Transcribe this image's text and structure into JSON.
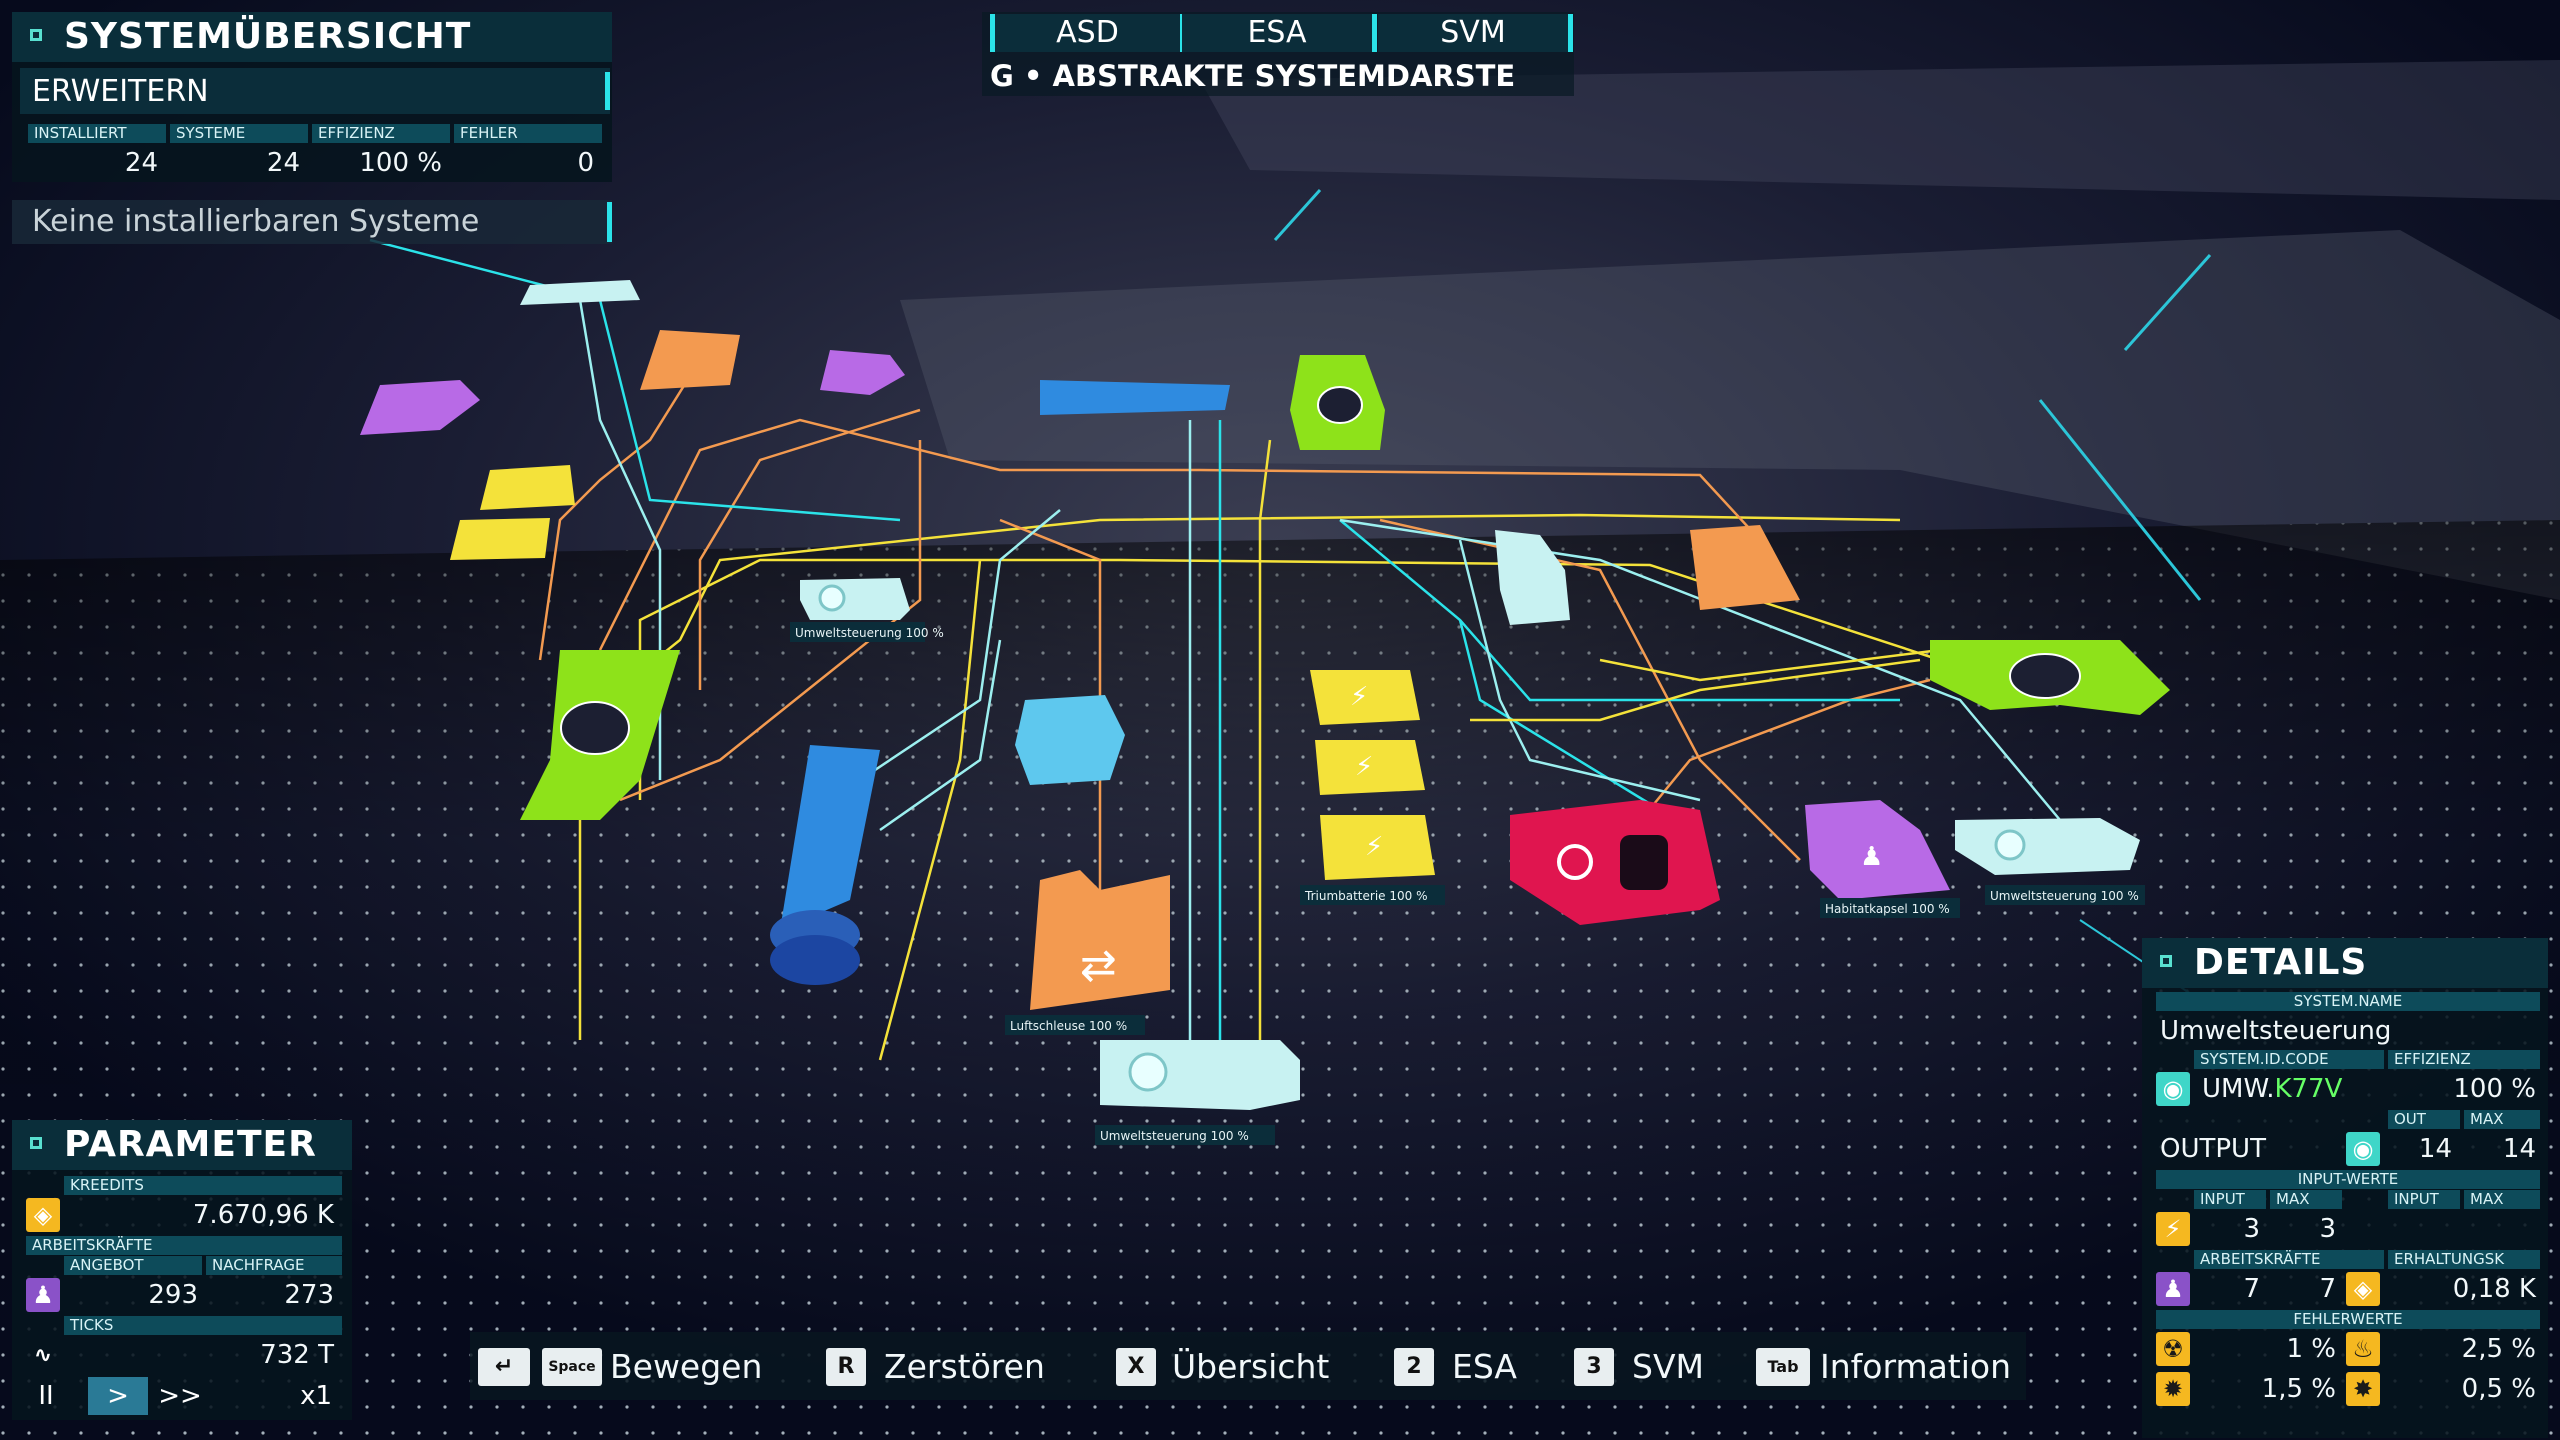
{
  "system_overview": {
    "title": "SYSTEMÜBERSICHT",
    "action": "ERWEITERN",
    "stats": [
      {
        "label": "INSTALLIERT",
        "value": "24"
      },
      {
        "label": "SYSTEME",
        "value": "24"
      },
      {
        "label": "EFFIZIENZ",
        "value": "100 %"
      },
      {
        "label": "FEHLER",
        "value": "0"
      }
    ],
    "message": "Keine installierbaren Systeme"
  },
  "top_tabs": {
    "tabs": [
      "ASD",
      "ESA",
      "SVM"
    ],
    "subtitle": "G • ABSTRAKTE SYSTEMDARSTE"
  },
  "parameter": {
    "title": "PARAMETER",
    "credits_label": "KREEDITS",
    "credits_value": "7.670,96 K",
    "workforce_label": "ARBEITSKRÄFTE",
    "supply_label": "ANGEBOT",
    "demand_label": "NACHFRAGE",
    "supply_value": "293",
    "demand_value": "273",
    "ticks_label": "TICKS",
    "ticks_value": "732 T",
    "controls": {
      "pause": "II",
      "play": ">",
      "fast": ">>",
      "speed": "x1"
    }
  },
  "details": {
    "title": "DETAILS",
    "system_name_label": "SYSTEM.NAME",
    "system_name": "Umweltsteuerung",
    "id_code_label": "SYSTEM.ID.CODE",
    "efficiency_label": "EFFIZIENZ",
    "id_prefix": "UMW.",
    "id_suffix": "K77V",
    "efficiency_value": "100 %",
    "out_label": "OUT",
    "max_label": "MAX",
    "output_label": "OUTPUT",
    "output_out": "14",
    "output_max": "14",
    "input_values_label": "INPUT-WERTE",
    "input_label": "INPUT",
    "input_max_label": "MAX",
    "input_label2": "INPUT",
    "input_max_label2": "MAX",
    "input_value": "3",
    "input_max": "3",
    "workforce_label": "ARBEITSKRÄFTE",
    "upkeep_label": "ERHALTUNGSK",
    "workforce_a": "7",
    "workforce_b": "7",
    "upkeep_value": "0,18 K",
    "error_values_label": "FEHLERWERTE",
    "errors": [
      "1 %",
      "2,5 %",
      "1,5 %",
      "0,5 %"
    ],
    "colors": {
      "accent": "#2be3e9",
      "id_green": "#66ff66",
      "icon_yellow": "#f5b820",
      "icon_purple": "#8a52c8"
    }
  },
  "hotkeys": [
    {
      "key": "Space",
      "label": "Bewegen"
    },
    {
      "key": "R",
      "label": "Zerstören"
    },
    {
      "key": "X",
      "label": "Übersicht"
    },
    {
      "key": "2",
      "label": "ESA"
    },
    {
      "key": "3",
      "label": "SVM"
    },
    {
      "key": "Tab",
      "label": "Information"
    }
  ],
  "map_labels": {
    "umwelt_main": "Umweltsteuerung  100 %",
    "luftschleuse": "Luftschleuse  100 %",
    "habitat": "Habitatkapsel  100 %",
    "umwelt_right": "Umweltsteuerung  100 %",
    "battery": "Triumbatterie  100 %",
    "umwelt_left": "Umweltsteuerung  100 %"
  },
  "node_colors": {
    "yellow": "#f4e23a",
    "orange": "#f39a50",
    "green": "#8ee21a",
    "cyan": "#c8f2f2",
    "purple": "#b86ae6",
    "blue": "#2f8be0",
    "red": "#e0154f",
    "lightblue": "#5ec8ee"
  }
}
